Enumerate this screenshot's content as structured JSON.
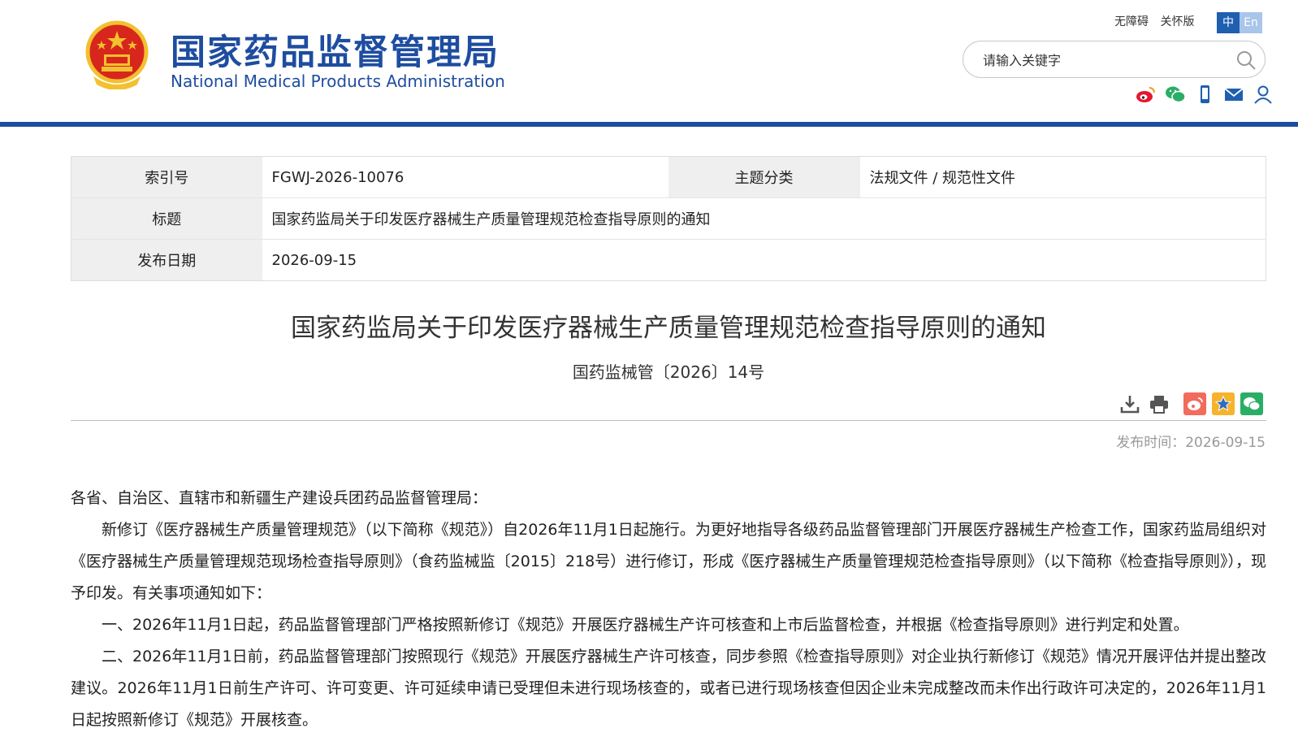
{
  "header": {
    "title_cn": "国家药品监督管理局",
    "title_en": "National Medical Products Administration",
    "links": [
      "无障碍",
      "关怀版"
    ],
    "lang_zh": "中",
    "lang_en": "En",
    "search_placeholder": "请输入关键字",
    "social_icons": [
      "weibo-icon",
      "wechat-icon",
      "mobile-icon",
      "mail-icon",
      "user-icon"
    ],
    "colors": {
      "brand": "#1e4da0",
      "emblem_red": "#d7261c",
      "emblem_gold": "#f3c02f"
    }
  },
  "info": {
    "index_label": "索引号",
    "index_value": "FGWJ-2026-10076",
    "topic_label": "主题分类",
    "topic_value": "法规文件 / 规范性文件",
    "title_label": "标题",
    "title_value": "国家药监局关于印发医疗器械生产质量管理规范检查指导原则的通知",
    "date_label": "发布日期",
    "date_value": "2026-09-15"
  },
  "article": {
    "title": "国家药监局关于印发医疗器械生产质量管理规范检查指导原则的通知",
    "doc_number": "国药监械管〔2026〕14号",
    "publish_time": "发布时间：2026-09-15",
    "tools": [
      "download-icon",
      "print-icon",
      "share-weibo-icon",
      "favorite-icon",
      "share-wechat-icon"
    ],
    "paragraphs": [
      "各省、自治区、直辖市和新疆生产建设兵团药品监督管理局：",
      "新修订《医疗器械生产质量管理规范》（以下简称《规范》）自2026年11月1日起施行。为更好地指导各级药品监督管理部门开展医疗器械生产检查工作，国家药监局组织对《医疗器械生产质量管理规范现场检查指导原则》（食药监械监〔2015〕218号）进行修订，形成《医疗器械生产质量管理规范检查指导原则》（以下简称《检查指导原则》），现予印发。有关事项通知如下：",
      "一、2026年11月1日起，药品监督管理部门严格按照新修订《规范》开展医疗器械生产许可核查和上市后监督检查，并根据《检查指导原则》进行判定和处置。",
      "二、2026年11月1日前，药品监督管理部门按照现行《规范》开展医疗器械生产许可核查，同步参照《检查指导原则》对企业执行新修订《规范》情况开展评估并提出整改建议。2026年11月1日前生产许可、许可变更、许可延续申请已受理但未进行现场核查的，或者已进行现场核查但因企业未完成整改而未作出行政许可决定的，2026年11月1日起按照新修订《规范》开展核查。"
    ]
  }
}
